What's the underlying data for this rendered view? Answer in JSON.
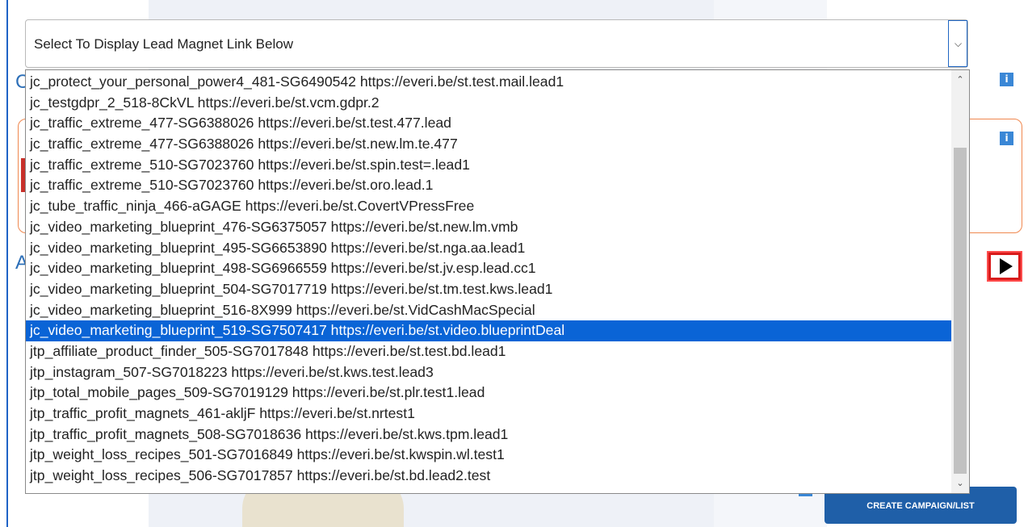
{
  "select": {
    "selected_label": "Select To Display Lead Magnet Link Below"
  },
  "options": [
    "jc_protect_your_personal_power4_481-SG6490542 https://everi.be/st.test.mail.lead1",
    "jc_testgdpr_2_518-8CkVL https://everi.be/st.vcm.gdpr.2",
    "jc_traffic_extreme_477-SG6388026 https://everi.be/st.test.477.lead",
    "jc_traffic_extreme_477-SG6388026 https://everi.be/st.new.lm.te.477",
    "jc_traffic_extreme_510-SG7023760 https://everi.be/st.spin.test=.lead1",
    "jc_traffic_extreme_510-SG7023760 https://everi.be/st.oro.lead.1",
    "jc_tube_traffic_ninja_466-aGAGE https://everi.be/st.CovertVPressFree",
    "jc_video_marketing_blueprint_476-SG6375057 https://everi.be/st.new.lm.vmb",
    "jc_video_marketing_blueprint_495-SG6653890 https://everi.be/st.nga.aa.lead1",
    "jc_video_marketing_blueprint_498-SG6966559 https://everi.be/st.jv.esp.lead.cc1",
    "jc_video_marketing_blueprint_504-SG7017719 https://everi.be/st.tm.test.kws.lead1",
    "jc_video_marketing_blueprint_516-8X999 https://everi.be/st.VidCashMacSpecial",
    "jc_video_marketing_blueprint_519-SG7507417 https://everi.be/st.video.blueprintDeal",
    "jtp_affiliate_product_finder_505-SG7017848 https://everi.be/st.test.bd.lead1",
    "jtp_instagram_507-SG7018223 https://everi.be/st.kws.test.lead3",
    "jtp_total_mobile_pages_509-SG7019129 https://everi.be/st.plr.test1.lead",
    "jtp_traffic_profit_magnets_461-akljF https://everi.be/st.nrtest1",
    "jtp_traffic_profit_magnets_508-SG7018636 https://everi.be/st.kws.tpm.lead1",
    "jtp_weight_loss_recipes_501-SG7016849 https://everi.be/st.kwspin.wl.test1",
    "jtp_weight_loss_recipes_506-SG7017857 https://everi.be/st.bd.lead2.test"
  ],
  "selected_index": 12,
  "buttons": {
    "create_campaign": "CREATE CAMPAIGN/LIST"
  },
  "icons": {
    "info_glyph": "i",
    "chevron_down": "⌵",
    "scroll_up": "⌃",
    "scroll_down": "⌄",
    "ghost_c": "C",
    "ghost_a": "A"
  }
}
